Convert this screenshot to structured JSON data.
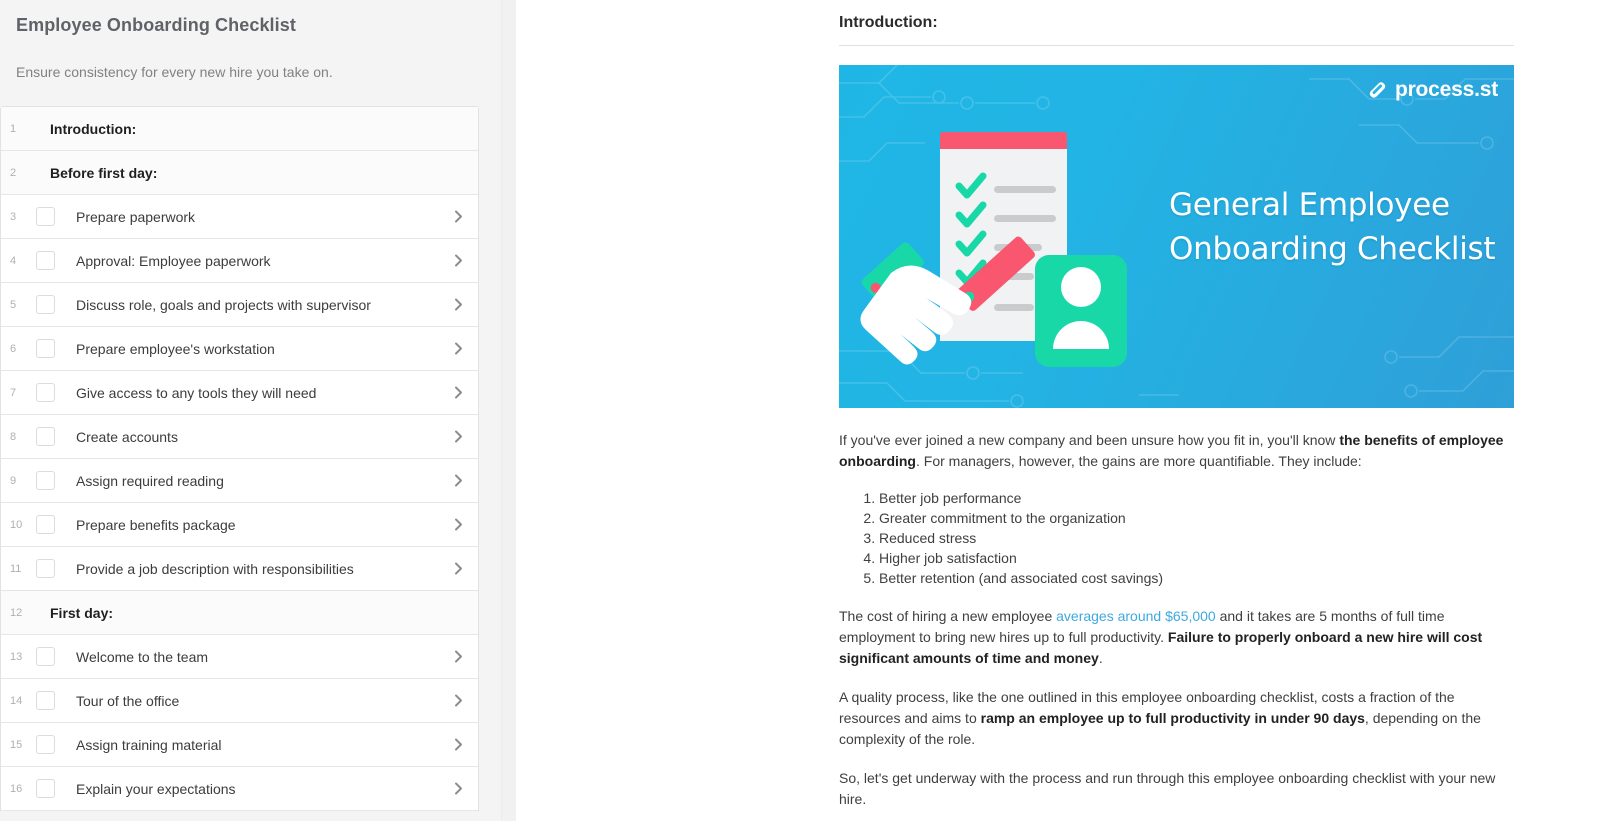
{
  "sidebar": {
    "title": "Employee Onboarding Checklist",
    "subtitle": "Ensure consistency for every new hire you take on.",
    "tasks": [
      {
        "num": "1",
        "label": "Introduction:",
        "type": "heading"
      },
      {
        "num": "2",
        "label": "Before first day:",
        "type": "heading"
      },
      {
        "num": "3",
        "label": "Prepare paperwork",
        "type": "task"
      },
      {
        "num": "4",
        "label": "Approval: Employee paperwork",
        "type": "task"
      },
      {
        "num": "5",
        "label": "Discuss role, goals and projects with supervisor",
        "type": "task"
      },
      {
        "num": "6",
        "label": "Prepare employee's workstation",
        "type": "task"
      },
      {
        "num": "7",
        "label": "Give access to any tools they will need",
        "type": "task"
      },
      {
        "num": "8",
        "label": "Create accounts",
        "type": "task"
      },
      {
        "num": "9",
        "label": "Assign required reading",
        "type": "task"
      },
      {
        "num": "10",
        "label": "Prepare benefits package",
        "type": "task"
      },
      {
        "num": "11",
        "label": "Provide a job description with responsibilities",
        "type": "task"
      },
      {
        "num": "12",
        "label": "First day:",
        "type": "heading"
      },
      {
        "num": "13",
        "label": "Welcome to the team",
        "type": "task"
      },
      {
        "num": "14",
        "label": "Tour of the office",
        "type": "task"
      },
      {
        "num": "15",
        "label": "Assign training material",
        "type": "task"
      },
      {
        "num": "16",
        "label": "Explain your expectations",
        "type": "task"
      }
    ]
  },
  "main": {
    "section_title": "Introduction:",
    "banner": {
      "logo_text": "process.st",
      "title_line1": "General Employee",
      "title_line2": "Onboarding Checklist",
      "bg_color": "#22b4e4",
      "accent_green": "#18d8a8",
      "accent_red": "#f9566f"
    },
    "paragraph1_pre": "If you've ever joined a new company and been unsure how you fit in, you'll know ",
    "paragraph1_bold": "the benefits of employee onboarding",
    "paragraph1_post": ". For managers, however, the gains are more quantifiable. They include:",
    "benefits": [
      "Better job performance",
      "Greater commitment to the organization",
      "Reduced stress",
      "Higher job satisfaction",
      "Better retention (and associated cost savings)"
    ],
    "paragraph2_pre": "The cost of hiring a new employee ",
    "paragraph2_link": "averages around $65,000",
    "paragraph2_mid": " and it takes are 5 months of full time employment to bring new hires up to full productivity. ",
    "paragraph2_bold": "Failure to properly onboard a new hire will cost significant amounts of time and money",
    "paragraph2_post": ".",
    "paragraph3_pre": "A quality process, like the one outlined in this employee onboarding checklist, costs a fraction of the resources and aims to ",
    "paragraph3_bold": "ramp an employee up to full productivity in under 90 days",
    "paragraph3_post": ", depending on the complexity of the role.",
    "paragraph4": "So, let's get underway with the process and run through this employee onboarding checklist with your new hire."
  }
}
